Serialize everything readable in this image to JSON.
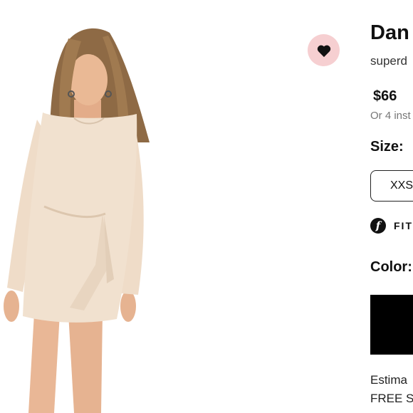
{
  "product": {
    "title": "Dan",
    "brand": "superd",
    "price": "$66",
    "installments": "Or 4 inst",
    "size_label": "Size:",
    "size_selected": "XXS",
    "fit_logo": "f",
    "fit_label": "FIT",
    "color_label": "Color:",
    "color_swatch": "#000000",
    "shipping_line1": "Estima",
    "shipping_line2": "FREE S"
  },
  "icons": {
    "favorite": "heart-icon",
    "fit": "fitfinder-icon"
  },
  "colors": {
    "favorite_bg": "#f6cfd1",
    "dress": "#f1e1cf"
  }
}
